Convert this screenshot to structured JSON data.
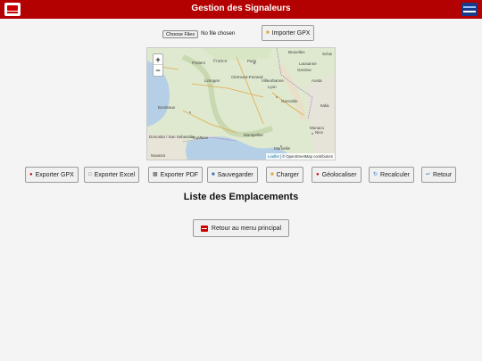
{
  "header": {
    "title": "Gestion des Signaleurs",
    "brand_color": "#b30000"
  },
  "file_input": {
    "choose_label": "Choose Files",
    "status": "No file chosen"
  },
  "import_button": {
    "label": "Importer GPX",
    "icon": "folder-open-icon"
  },
  "map": {
    "zoom_in": "+",
    "zoom_out": "−",
    "attribution_leaflet": "Leaflet",
    "attribution_osm": "| © OpenStreetMap contributors",
    "labels": {
      "france": "France",
      "paris": "Paris",
      "bruxelles": "Bruxelles",
      "schw": "Schw",
      "lausanne": "Lausanne",
      "geneve": "Genève",
      "poitiers": "Poitiers",
      "limoges": "Limoges",
      "clermont": "Clermont-Ferrand",
      "villeurbanne": "Villeurbanne",
      "lyon": "Lyon",
      "grenoble": "Grenoble",
      "bordeaux": "Bordeaux",
      "toulouse": "Toulouse",
      "montpellier": "Montpellier",
      "marseille": "Marseille",
      "nice": "Nice",
      "monaco": "Monaco",
      "navarra": "Navarra",
      "sebastian": "Donostia / San Sebastián",
      "italia": "Italia",
      "aosta": "Aosta"
    }
  },
  "toolbar": {
    "buttons": [
      {
        "label": "Exporter GPX",
        "icon": "map-pin-icon"
      },
      {
        "label": "Exporter Excel",
        "icon": "document-icon"
      },
      {
        "label": "Exporter PDF",
        "icon": "printer-icon"
      },
      {
        "label": "Sauvegarder",
        "icon": "floppy-disk-icon"
      },
      {
        "label": "Charger",
        "icon": "folder-icon"
      },
      {
        "label": "Géolocaliser",
        "icon": "map-pin-icon"
      },
      {
        "label": "Recalculer",
        "icon": "refresh-icon"
      },
      {
        "label": "Retour",
        "icon": "back-arrow-icon"
      }
    ]
  },
  "list": {
    "title": "Liste des Emplacements"
  },
  "back_main": {
    "label": "Retour au menu principal"
  }
}
